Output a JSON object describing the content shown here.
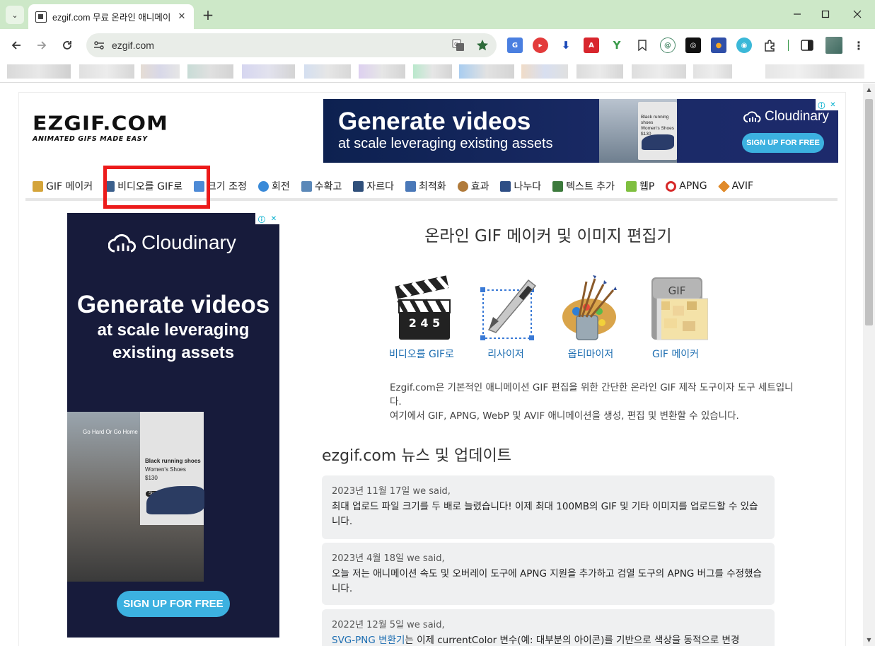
{
  "browser": {
    "tab_title": "ezgif.com 무료 온라인 애니메이",
    "url": "ezgif.com",
    "new_tab": "+",
    "tab_close": "✕",
    "tab_menu": "⌄"
  },
  "site": {
    "logo_main": "EZGIF.COM",
    "logo_sub": "ANIMATED GIFS MADE EASY"
  },
  "ad_top": {
    "headline": "Generate videos",
    "subline": "at scale leveraging existing assets",
    "brand": "Cloudinary",
    "button": "SIGN UP FOR FREE",
    "card_text": "Black running shoes\nWomen's Shoes\n$130"
  },
  "nav": {
    "items": [
      {
        "label": "GIF 메이커",
        "color": "#d4a43a"
      },
      {
        "label": "비디오를 GIF로",
        "color": "#3b5f8c"
      },
      {
        "label": "크기 조정",
        "color": "#4d8ad6"
      },
      {
        "label": "회전",
        "color": "#3a8ad8"
      },
      {
        "label": "수확고",
        "color": "#5b88b8"
      },
      {
        "label": "자르다",
        "color": "#2f4f7a"
      },
      {
        "label": "최적화",
        "color": "#4a78b8"
      },
      {
        "label": "효과",
        "color": "#b07a3a"
      },
      {
        "label": "나누다",
        "color": "#2e4e85"
      },
      {
        "label": "텍스트 추가",
        "color": "#3c7a3c"
      },
      {
        "label": "웹P",
        "color": "#7fbf3f"
      },
      {
        "label": "APNG",
        "color": "#d62828"
      },
      {
        "label": "AVIF",
        "color": "#e08a2a"
      }
    ]
  },
  "ad_side": {
    "brand": "Cloudinary",
    "headline": "Generate videos",
    "subline_1": "at scale leveraging",
    "subline_2": "existing assets",
    "photo_text": "Go Hard Or Go Home",
    "card_title": "Black running shoes",
    "card_sub": "Women's Shoes",
    "card_price": "$130",
    "card_btn": "Shop",
    "button": "SIGN UP FOR FREE"
  },
  "main": {
    "headline": "온라인 GIF 메이커 및 이미지 편집기",
    "features": [
      {
        "label": "비디오를 GIF로",
        "icon": "clapperboard-icon"
      },
      {
        "label": "리사이저",
        "icon": "resize-icon"
      },
      {
        "label": "옵티마이저",
        "icon": "paint-palette-icon"
      },
      {
        "label": "GIF 메이커",
        "icon": "gif-file-icon"
      }
    ],
    "clapper_digits": "2 4 5",
    "gif_badge": "GIF",
    "intro_1": "Ezgif.com은 기본적인 애니메이션 GIF 편집을 위한 간단한 온라인 GIF 제작 도구이자 도구 세트입니다.",
    "intro_2": "여기에서 GIF, APNG, WebP 및 AVIF 애니메이션을 생성, 편집 및 변환할 수 있습니다."
  },
  "news": {
    "title": "ezgif.com 뉴스 및 업데이트",
    "items": [
      {
        "date": "2023년 11월 17일 we said,",
        "text": "최대 업로드 파일 크기를 두 배로 늘렸습니다! 이제 최대 100MB의 GIF 및 기타 이미지를 업로드할 수 있습니다."
      },
      {
        "date": "2023년 4월 18일 we said,",
        "text": "오늘 저는 애니메이션 속도 및 오버레이 도구에 APNG 지원을 추가하고 검열 도구의 APNG 버그를 수정했습니다."
      },
      {
        "date": "2022년 12월 5일 we said,",
        "link": "SVG-PNG 변환기",
        "text": "는 이제 currentColor 변수(예: 대부분의 아이콘)를 기반으로 색상을 동적으로 변경"
      }
    ]
  }
}
